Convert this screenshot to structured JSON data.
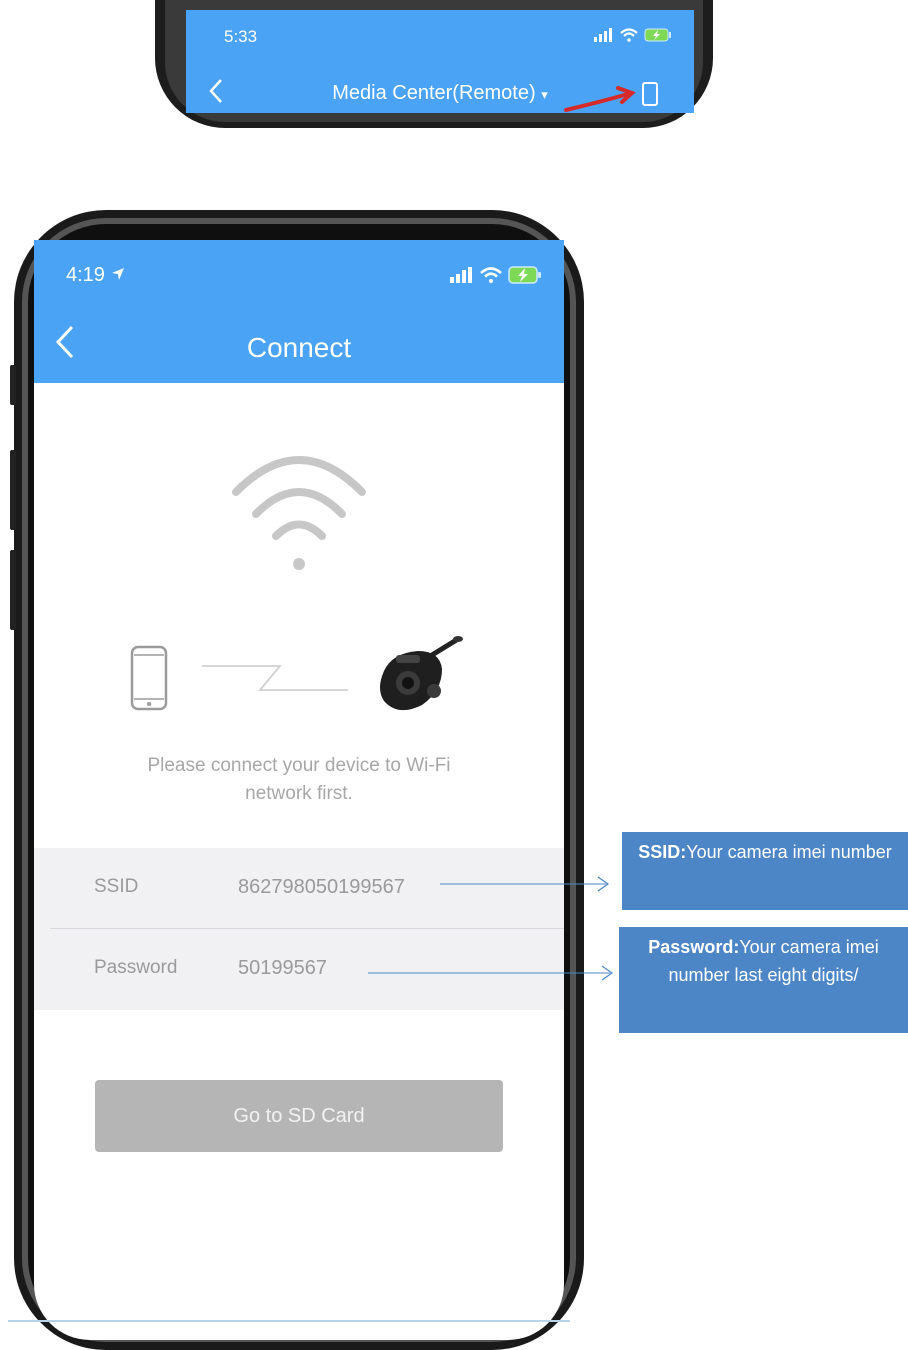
{
  "top_screen": {
    "time": "5:33",
    "back_icon": "chevron-left-icon",
    "title": "Media Center(Remote)",
    "title_caret": "▾",
    "device_icon": "phone-device-icon",
    "arrow_color": "#d62a2a"
  },
  "status_bar": {
    "time": "4:19",
    "location_icon": "location-arrow-icon",
    "signal_icon": "signal-icon",
    "wifi_icon": "wifi-icon",
    "battery_icon": "battery-charging-icon"
  },
  "header": {
    "title": "Connect",
    "back_icon": "chevron-left-icon",
    "color": "#4aa3f4"
  },
  "illustration": {
    "wifi_icon": "wifi-icon",
    "phone_icon": "smartphone-icon",
    "camera_icon": "dashcam-icon"
  },
  "instruction": {
    "line1": "Please connect your device to Wi-Fi",
    "line2": "network first."
  },
  "credentials": {
    "ssid_label": "SSID",
    "ssid_value": "862798050199567",
    "password_label": "Password",
    "password_value": "50199567"
  },
  "buttons": {
    "sd_card": "Go to SD Card"
  },
  "annotations": {
    "ssid_bold": "SSID:",
    "ssid_text": "Your camera imei number",
    "password_bold": "Password:",
    "password_text": "Your camera imei number last eight digits/",
    "color": "#4d86c6"
  }
}
